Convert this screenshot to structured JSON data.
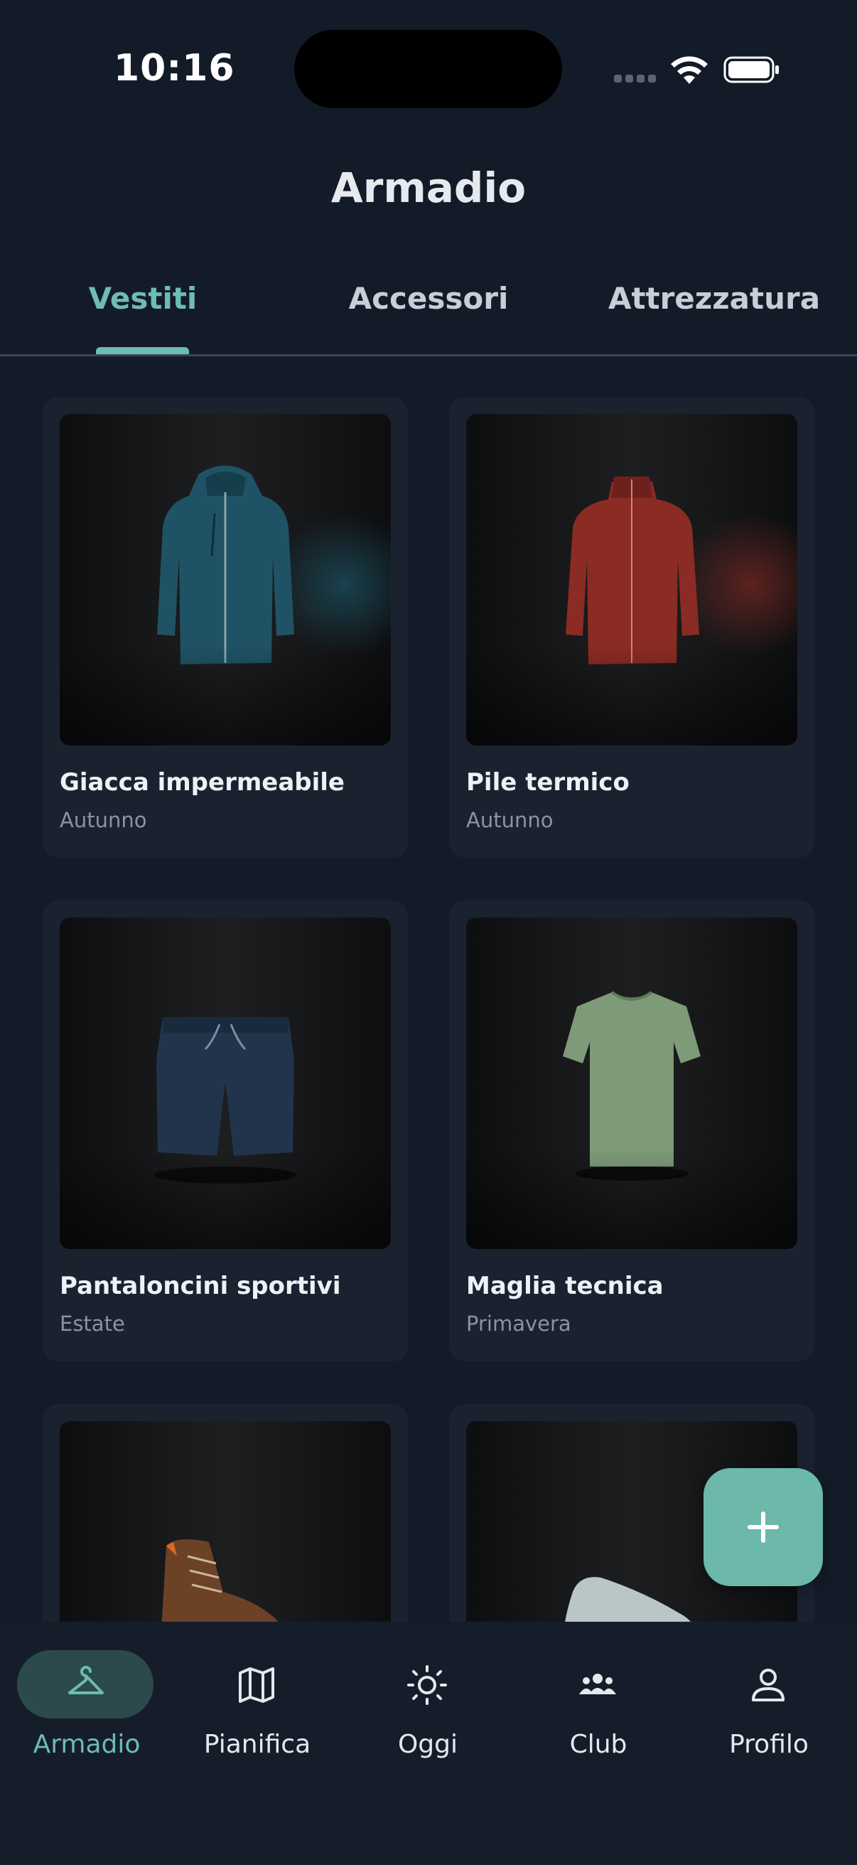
{
  "status_bar": {
    "time": "10:16"
  },
  "header": {
    "title": "Armadio"
  },
  "tabs": [
    {
      "label": "Vestiti",
      "active": true
    },
    {
      "label": "Accessori",
      "active": false
    },
    {
      "label": "Attrezzatura",
      "active": false
    }
  ],
  "items": [
    {
      "name": "Giacca impermeabile",
      "season": "Autunno",
      "image": "teal-rain-jacket",
      "accent": "#1e5566"
    },
    {
      "name": "Pile termico",
      "season": "Autunno",
      "image": "red-fleece-jacket",
      "accent": "#7a2a24"
    },
    {
      "name": "Pantaloncini sportivi",
      "season": "Estate",
      "image": "navy-shorts",
      "accent": "#1f3148"
    },
    {
      "name": "Maglia tecnica",
      "season": "Primavera",
      "image": "green-tshirt",
      "accent": "#7e9a78"
    },
    {
      "name": "",
      "season": "",
      "image": "brown-hiking-boot",
      "accent": "#6b4226"
    },
    {
      "name": "",
      "season": "",
      "image": "grey-running-shoe",
      "accent": "#b9c6c8"
    }
  ],
  "fab": {
    "icon": "plus-icon",
    "color": "#6cb8ab"
  },
  "bottom_nav": [
    {
      "label": "Armadio",
      "icon": "hanger-icon",
      "active": true
    },
    {
      "label": "Pianifica",
      "icon": "map-icon",
      "active": false
    },
    {
      "label": "Oggi",
      "icon": "sun-icon",
      "active": false
    },
    {
      "label": "Club",
      "icon": "group-icon",
      "active": false
    },
    {
      "label": "Profilo",
      "icon": "user-icon",
      "active": false
    }
  ],
  "colors": {
    "background": "#131b28",
    "accent": "#6cbcb0",
    "card": "#1a2230"
  }
}
